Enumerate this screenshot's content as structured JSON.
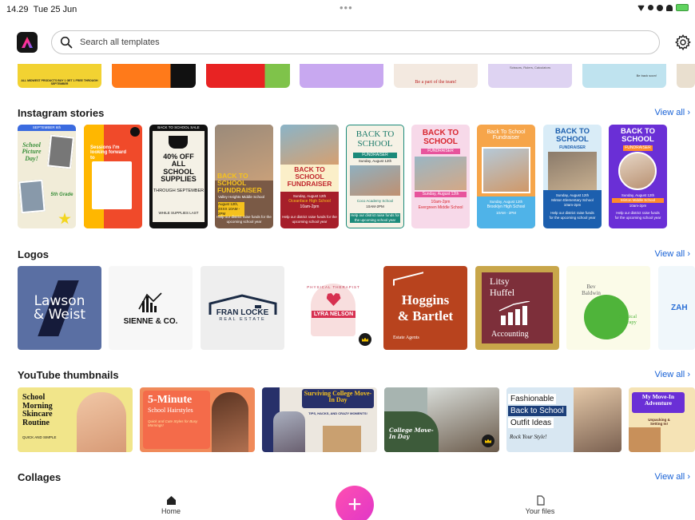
{
  "status_bar": {
    "time": "14.29",
    "date": "Tue 25 Jun",
    "dots": "•••"
  },
  "search": {
    "placeholder": "Search all templates"
  },
  "strip_preview": {
    "text_1": "ALL MIDWEST PRODUCTS BUY 1 GET 1 FREE THROUGH SEPTEMBER",
    "text_2": "Be a part of the team!",
    "text_3": "Scissors, Rulers, Calculators",
    "text_4": "Be back soon!"
  },
  "sections": {
    "instagram": {
      "title": "Instagram stories",
      "view_all": "View all",
      "cards": [
        {
          "top": "SEPTEMBER 6th",
          "head": "School Picture Day!",
          "sub": "5th Grade"
        },
        {
          "head": "Sessions I'm looking forward to"
        },
        {
          "top": "BACK TO SCHOOL SALE",
          "head": "40% OFF ALL SCHOOL SUPPLIES",
          "sub": "THROUGH SEPTEMBER",
          "foot": "WHILE SUPPLIES LAST"
        },
        {
          "head": "BACK TO SCHOOL FUNDRAISER",
          "sub": "Valley Heights Middle School",
          "date": "August 12th, 2XXX 10AM - 2PM",
          "foot": "Help our district raise funds for the upcoming school year"
        },
        {
          "head": "BACK TO SCHOOL FUNDRAISER",
          "sub": "Sunday, August 12th",
          "school": "Oceanface High School",
          "time": "10am-2pm",
          "foot": "Help our district raise funds for the upcoming school year"
        },
        {
          "head": "BACK TO SCHOOL",
          "sub": "FUNDRAISER",
          "date": "Sunday, August 12th",
          "school": "Coco Academy School",
          "time": "10AM-2PM",
          "foot": "Help our district raise funds for the upcoming school year"
        },
        {
          "head": "BACK TO SCHOOL",
          "sub": "FUNDRAISER",
          "date": "Sunday, August 12th",
          "time": "10am-2pm",
          "school": "Evergreen Middle School"
        },
        {
          "head": "Back To School Fundraiser",
          "date": "Sunday, August 12th",
          "school": "Brooklyn High School",
          "time": "10AM - 2PM"
        },
        {
          "head": "BACK TO SCHOOL",
          "sub": "FUNDRAISER",
          "date": "Sunday, August 12th",
          "school": "Minton Elementary School",
          "time": "10am-2pm",
          "foot": "Help our district raise funds for the upcoming school year"
        },
        {
          "head": "BACK TO SCHOOL",
          "sub": "FUNDRAISER",
          "date": "Sunday, August 12th",
          "school": "Minton Middle School",
          "time": "10am-2pm",
          "foot": "Help our district raise funds for the upcoming school year"
        }
      ]
    },
    "logos": {
      "title": "Logos",
      "view_all": "View all",
      "cards": [
        {
          "name": "Lawson & Weist"
        },
        {
          "name": "SIENNE & CO."
        },
        {
          "name": "FRAN LOCKE",
          "sub": "REAL ESTATE"
        },
        {
          "name": "LYRA NELSON",
          "arc": "PHYSICAL THERAPIST"
        },
        {
          "name_1": "Hoggins",
          "name_2": "& Bartlet",
          "sub": "Estate Agents"
        },
        {
          "name_1": "Litsy",
          "name_2": "Huffel",
          "sub": "Accounting"
        },
        {
          "name": "Bev Baldwin",
          "sub": "Physical Therapy"
        },
        {
          "name": "ZAH"
        }
      ]
    },
    "youtube": {
      "title": "YouTube thumbnails",
      "view_all": "View all",
      "cards": [
        {
          "title": "School Morning Skincare Routine",
          "sub": "QUICK AND SIMPLE"
        },
        {
          "title": "5-Minute",
          "title2": "School Hairstyles",
          "sub": "Quick and Cute Styles for Busy Mornings!"
        },
        {
          "title": "Surviving College Move-In Day",
          "sub": "TIPS, HACKS, AND CRAZY MOMENTS!"
        },
        {
          "title": "College Move-In Day"
        },
        {
          "line1": "Fashionable",
          "line2": "Back to School",
          "line3": "Outfit Ideas",
          "sub": "Rock Your Style!"
        },
        {
          "title": "My Move-In Adventure",
          "sub": "Unpacking & Setting In!"
        }
      ]
    },
    "collages": {
      "title": "Collages",
      "view_all": "View all"
    }
  },
  "bottom_nav": {
    "home": "Home",
    "create": "+",
    "files": "Your files"
  },
  "colors": {
    "accent_link": "#1761d6",
    "fab": "#e036c9",
    "premium_crown": "#f2c200"
  }
}
